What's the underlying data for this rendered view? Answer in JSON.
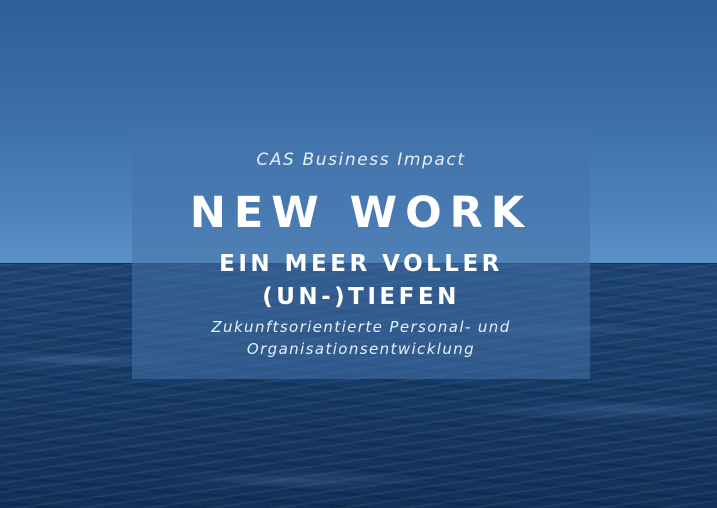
{
  "background": {
    "sky_color": "#3b6da6",
    "sea_color": "#1a3f6d"
  },
  "panel": {
    "overlay_color": "#4673aa",
    "subtitle": "CAS Business Impact",
    "title": "NEW WORK",
    "title_line2": [
      "EIN MEER VOLLER",
      "(UN-)TIEFEN"
    ],
    "description": [
      "Zukunftsorientierte Personal- und",
      "Organisationsentwicklung"
    ]
  }
}
